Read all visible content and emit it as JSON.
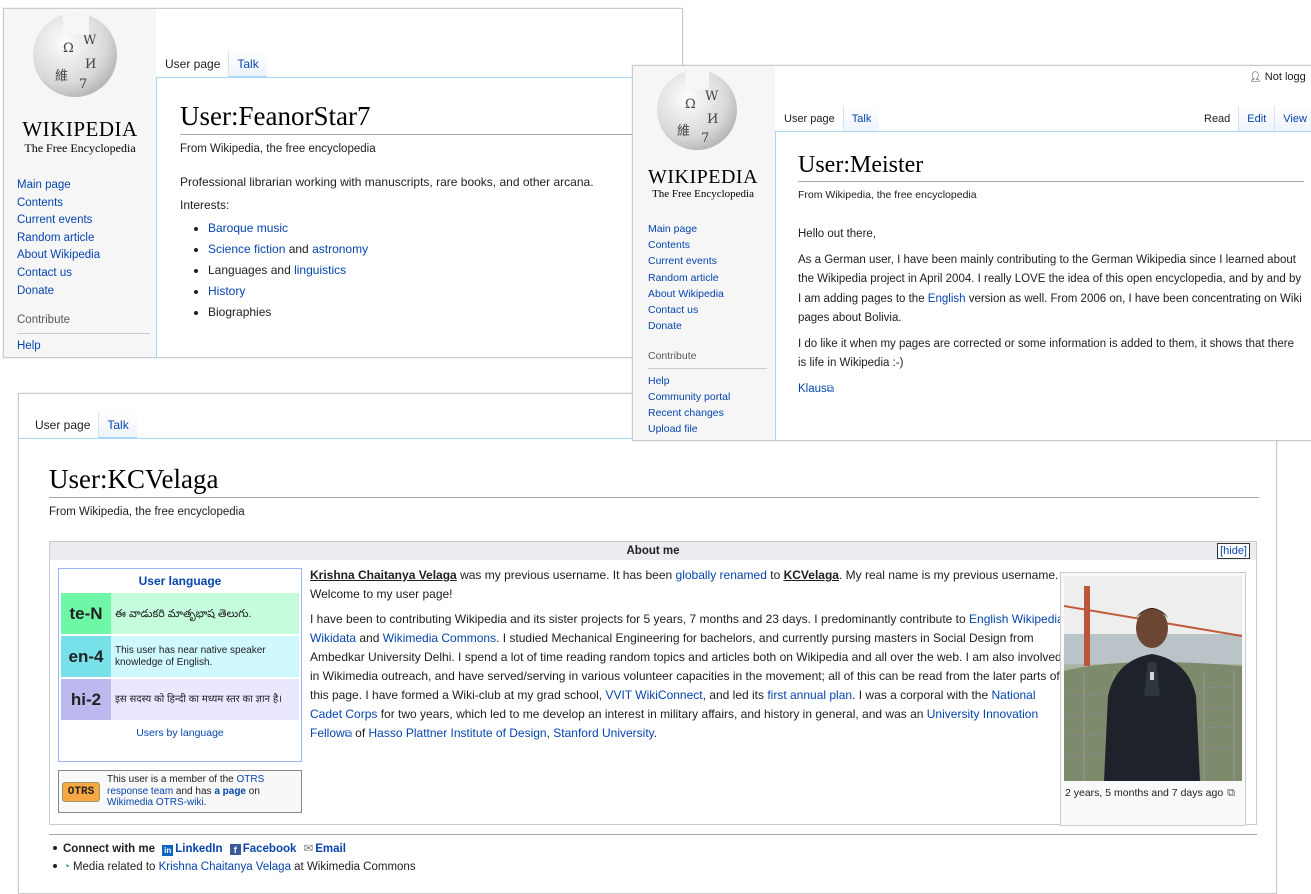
{
  "logo": {
    "wordmark": "WIKIPEDIA",
    "tagline": "The Free Encyclopedia",
    "glyphs": [
      "Ω",
      "W",
      "И",
      "維",
      "7",
      "W"
    ]
  },
  "panel1": {
    "tabs": [
      "User page",
      "Talk"
    ],
    "title": "User:FeanorStar7",
    "from": "From Wikipedia, the free encyclopedia",
    "nav": [
      "Main page",
      "Contents",
      "Current events",
      "Random article",
      "About Wikipedia",
      "Contact us",
      "Donate"
    ],
    "contribute_heading": "Contribute",
    "contribute": [
      "Help"
    ],
    "intro": "Professional librarian working with manuscripts, rare books, and other arcana.",
    "interests_label": "Interests:",
    "interests": {
      "baroque": "Baroque music",
      "scifi": "Science fiction",
      "and1": " and ",
      "astronomy": "astronomy",
      "languages": "Languages and ",
      "linguistics": "linguistics",
      "history": "History",
      "biographies": "Biographies"
    }
  },
  "panel2": {
    "user_status": "Not logg",
    "tabs": [
      "User page",
      "Talk"
    ],
    "right_tabs": [
      "Read",
      "Edit",
      "View h"
    ],
    "title": "User:Meister",
    "from": "From Wikipedia, the free encyclopedia",
    "nav": [
      "Main page",
      "Contents",
      "Current events",
      "Random article",
      "About Wikipedia",
      "Contact us",
      "Donate"
    ],
    "contribute_heading": "Contribute",
    "contribute": [
      "Help",
      "Community portal",
      "Recent changes",
      "Upload file"
    ],
    "greeting": "Hello out there,",
    "para1_a": "As a German user, I have been mainly contributing to the German Wikipedia since I learned about the Wikipedia project in April 2004. I really LOVE the idea of this open encyclopedia, and by and by I am adding pages to the ",
    "para1_link": "English",
    "para1_b": " version as well. From 2006 on, I have been concentrating on Wiki pages about Bolivia.",
    "para2": "I do like it when my pages are corrected or some information is added to them, it shows that there is life in Wikipedia :-)",
    "signature": "Klaus"
  },
  "panel3": {
    "tabs": [
      "User page",
      "Talk"
    ],
    "title": "User:KCVelaga",
    "from": "From Wikipedia, the free encyclopedia",
    "about_heading": "About me",
    "hide": "[hide]",
    "babel": {
      "title": "User language",
      "boxes": [
        {
          "code": "te-N",
          "text": "ఈ వాడుకరి మాతృభాష తెలుగు.",
          "color": "#6ef7a7",
          "bg": "#c5fcdc"
        },
        {
          "code": "en-4",
          "text": "This user has near native speaker knowledge of English.",
          "color": "#77e0e8",
          "bg": "#d0f8ff"
        },
        {
          "code": "hi-2",
          "text": "इस सदस्य को हिन्दी का मध्यम स्तर का ज्ञान है।",
          "color": "#bcb9ef",
          "bg": "#e9e8ff"
        }
      ],
      "footer": "Users by language"
    },
    "otrs": {
      "badge": "OTRS",
      "line1a": "This user is a member of the ",
      "line1b": "OTRS",
      "line2a": "response team",
      "line2b": " and has ",
      "line2c": "a page",
      "line2d": " on",
      "line3": "Wikimedia OTRS-wiki",
      "line3end": "."
    },
    "about": {
      "p1_a": "Krishna Chaitanya Velaga",
      "p1_b": " was my previous username. It has been ",
      "p1_link": "globally renamed",
      "p1_c": " to ",
      "p1_d": "KCVelaga",
      "p1_e": ". My real name is my previous username. Welcome to my user page!",
      "p2_a": "I have been to contributing Wikipedia and its sister projects for 5 years, 7 months and 23 days. I predominantly contribute to ",
      "p2_l1": "English Wikipedia",
      "p2_b": ", ",
      "p2_l2": "Wikidata",
      "p2_c": " and ",
      "p2_l3": "Wikimedia Commons",
      "p2_d": ". I studied Mechanical Engineering for bachelors, and currently pursing masters in Social Design from Ambedkar University Delhi. I spend a lot of time reading random topics and articles both on Wikipedia and all over the web. I am also involved in Wikimedia outreach, and have served/serving in various volunteer capacities in the movement; all of this can be read from the later parts of this page. I have formed a Wiki-club at my grad school, ",
      "p2_l4": "VVIT WikiConnect",
      "p2_e": ", and led its ",
      "p2_l5": "first annual plan",
      "p2_f": ". I was a corporal with the ",
      "p2_l6": "National Cadet Corps",
      "p2_g": " for two years, which led to me develop an interest in military affairs, and history in general, and was an ",
      "p2_l7": "University Innovation Fellow",
      "p2_h": " of ",
      "p2_l8": "Hasso Plattner Institute of Design",
      "p2_i": ", ",
      "p2_l9": "Stanford University",
      "p2_j": "."
    },
    "photo_caption": "2 years, 5 months and 7 days ago",
    "footer": {
      "connect": "Connect with me",
      "linkedin": "LinkedIn",
      "facebook": "Facebook",
      "email": "Email",
      "media_a": "Media related to ",
      "media_link": "Krishna Chaitanya Velaga",
      "media_b": " at Wikimedia Commons"
    }
  }
}
